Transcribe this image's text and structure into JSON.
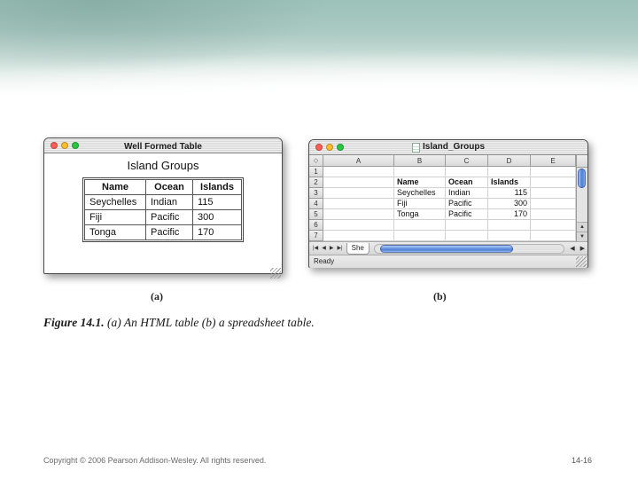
{
  "colors": {
    "banner_teal": "#9cc2b9",
    "scroll_thumb_blue": "#4d7fd6",
    "close_red": "#ff5f57",
    "minimize_yellow": "#febc2e",
    "zoom_green": "#28c840"
  },
  "icons": {
    "corner_diamond": "◇",
    "vscroll_up": "▲",
    "vscroll_down": "▼",
    "hscroll_left": "◀",
    "hscroll_right": "▶",
    "tab_first": "|◀",
    "tab_prev": "◀",
    "tab_next": "▶",
    "tab_last": "▶|"
  },
  "window_a": {
    "title": "Well Formed Table",
    "heading": "Island Groups",
    "table": {
      "headers": [
        "Name",
        "Ocean",
        "Islands"
      ],
      "rows": [
        [
          "Seychelles",
          "Indian",
          "115"
        ],
        [
          "Fiji",
          "Pacific",
          "300"
        ],
        [
          "Tonga",
          "Pacific",
          "170"
        ]
      ]
    }
  },
  "window_b": {
    "title": "Island_Groups",
    "columns": [
      "A",
      "B",
      "C",
      "D",
      "E"
    ],
    "rows": [
      "1",
      "2",
      "3",
      "4",
      "5",
      "6",
      "7"
    ],
    "data": [
      {
        "row": "2",
        "B": "Name",
        "C": "Ocean",
        "D": "Islands"
      },
      {
        "row": "3",
        "B": "Seychelles",
        "C": "Indian",
        "D": "115"
      },
      {
        "row": "4",
        "B": "Fiji",
        "C": "Pacific",
        "D": "300"
      },
      {
        "row": "5",
        "B": "Tonga",
        "C": "Pacific",
        "D": "170"
      }
    ],
    "sheet_tab": "She",
    "status": "Ready"
  },
  "figure": {
    "label_a": "(a)",
    "label_b": "(b)",
    "caption_label": "Figure 14.1.",
    "caption_text": "(a) An HTML table (b) a spreadsheet table."
  },
  "footer": {
    "copyright": "Copyright © 2006 Pearson Addison-Wesley. All rights reserved.",
    "page": "14-16"
  }
}
